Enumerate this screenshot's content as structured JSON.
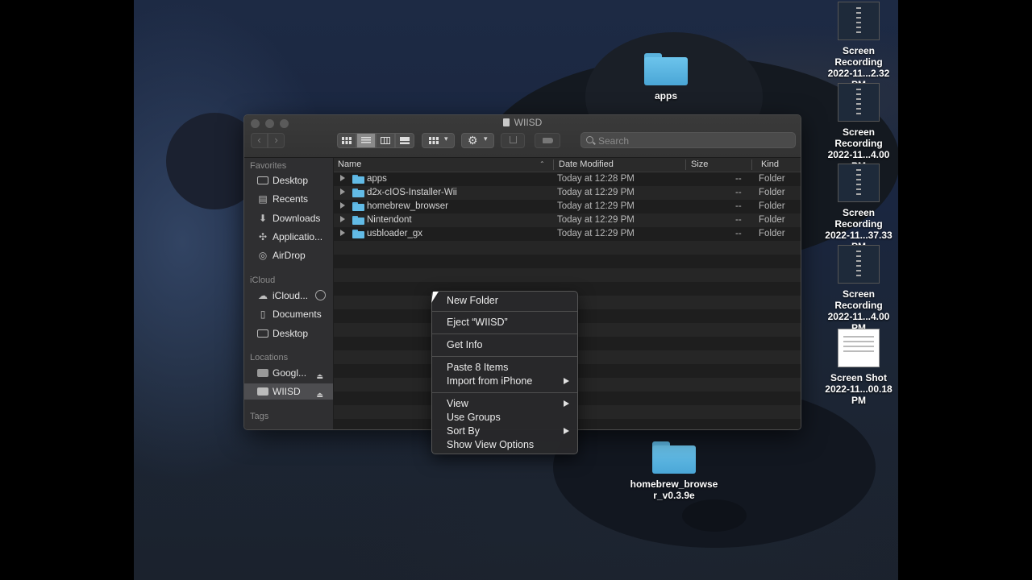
{
  "desktop": {
    "icons": [
      {
        "label": "apps",
        "kind": "folder"
      },
      {
        "label": "homebrew_browser_v0.3.9e",
        "line1": "homebrew_browse",
        "line2": "r_v0.3.9e",
        "kind": "folder"
      },
      {
        "line1": "Screen Recording",
        "line2": "2022-11...2.32 PM",
        "kind": "video"
      },
      {
        "line1": "Screen Recording",
        "line2": "2022-11...4.00 PM",
        "kind": "video"
      },
      {
        "line1": "Screen Recording",
        "line2": "2022-11...37.33 PM",
        "kind": "video"
      },
      {
        "line1": "Screen Recording",
        "line2": "2022-11...4.00 PM",
        "kind": "video"
      },
      {
        "line1": "Screen Shot",
        "line2": "2022-11...00.18 PM",
        "kind": "image"
      }
    ]
  },
  "window": {
    "title": "WIISD",
    "search_placeholder": "Search",
    "sidebar": {
      "favorites_header": "Favorites",
      "favorites": [
        "Desktop",
        "Recents",
        "Downloads",
        "Applicatio...",
        "AirDrop"
      ],
      "icloud_header": "iCloud",
      "icloud": [
        "iCloud...",
        "Documents",
        "Desktop"
      ],
      "locations_header": "Locations",
      "locations": [
        "Googl...",
        "WIISD"
      ],
      "tags_header": "Tags"
    },
    "columns": {
      "name": "Name",
      "date": "Date Modified",
      "size": "Size",
      "kind": "Kind"
    },
    "files": [
      {
        "name": "apps",
        "date": "Today at 12:28 PM",
        "size": "--",
        "kind": "Folder"
      },
      {
        "name": "d2x-cIOS-Installer-Wii",
        "date": "Today at 12:29 PM",
        "size": "--",
        "kind": "Folder"
      },
      {
        "name": "homebrew_browser",
        "date": "Today at 12:29 PM",
        "size": "--",
        "kind": "Folder"
      },
      {
        "name": "Nintendont",
        "date": "Today at 12:29 PM",
        "size": "--",
        "kind": "Folder"
      },
      {
        "name": "usbloader_gx",
        "date": "Today at 12:29 PM",
        "size": "--",
        "kind": "Folder"
      }
    ]
  },
  "context_menu": {
    "items": [
      "New Folder",
      "Eject “WIISD”",
      "Get Info",
      "Paste 8 Items",
      "Import from iPhone",
      "View",
      "Use Groups",
      "Sort By",
      "Show View Options"
    ]
  },
  "colors": {
    "folder": "#62bbe6",
    "selection": "#4d4d50"
  }
}
